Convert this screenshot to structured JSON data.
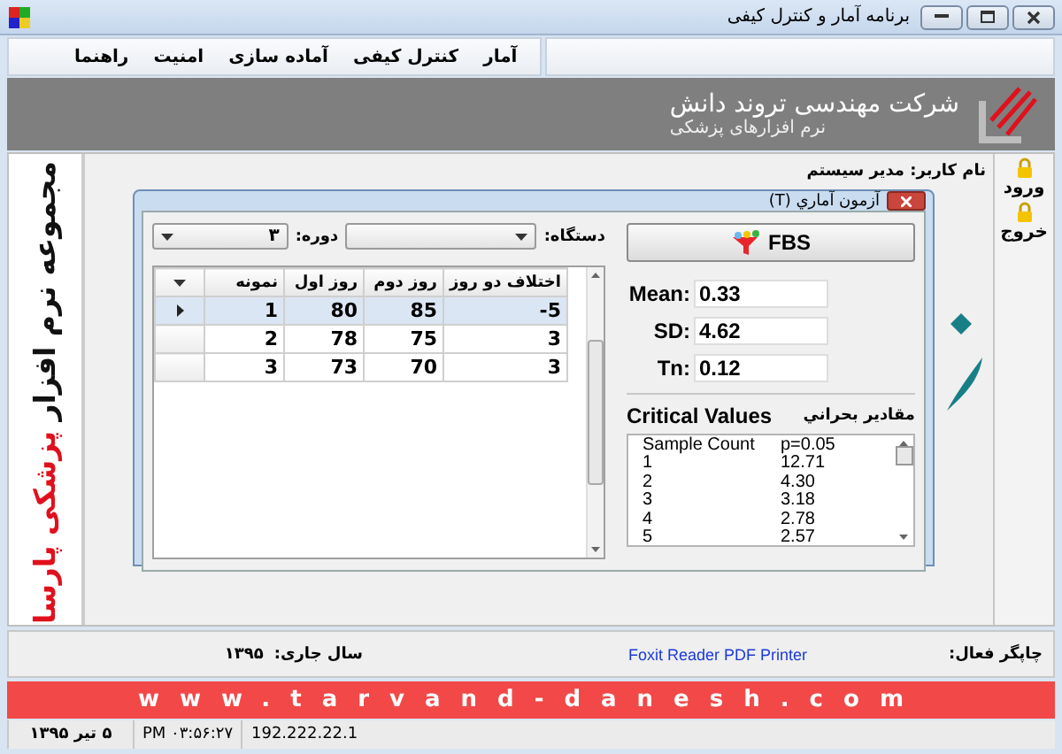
{
  "window": {
    "title": "برنامه آمار و کنترل کیفی"
  },
  "menu": [
    "آمار",
    "کنترل کیفی",
    "آماده سازی",
    "امنیت",
    "راهنما"
  ],
  "banner": {
    "company": "شرکت مهندسی تروند دانش",
    "subtitle": "نرم افزارهای پزشکی"
  },
  "side_text": [
    {
      "text": "مجموعه نرم افزار",
      "color": "#111111"
    },
    {
      "text": "پزشکی پارسا",
      "color": "#e0101c"
    }
  ],
  "user_label": "نام کاربر: مدیر سیستم",
  "sidebar": [
    "ورود",
    "خروج"
  ],
  "dialog": {
    "title": "آزمون آماري (T)",
    "device_label": "دستگاه:",
    "period_label": "دوره:",
    "period_value": "۳",
    "table": {
      "columns": [
        "اختلاف دو روز",
        "روز دوم",
        "روز اول",
        "نمونه"
      ],
      "rows": [
        {
          "cells": [
            "-5",
            "85",
            "80",
            "1"
          ],
          "selected": true
        },
        {
          "cells": [
            "3",
            "75",
            "78",
            "2"
          ],
          "selected": false
        },
        {
          "cells": [
            "3",
            "70",
            "73",
            "3"
          ],
          "selected": false
        }
      ]
    },
    "test_button": "FBS",
    "stats": [
      {
        "label": "Mean:",
        "value": "0.33"
      },
      {
        "label": "SD:",
        "value": "4.62"
      },
      {
        "label": "Tn:",
        "value": "0.12"
      }
    ],
    "critical": {
      "title": "Critical Values",
      "title_fa": "مقادير بحراني",
      "columns": [
        "p=0.05",
        "Sample Count"
      ],
      "rows": [
        [
          "12.71",
          "1"
        ],
        [
          "4.30",
          "2"
        ],
        [
          "3.18",
          "3"
        ],
        [
          "2.78",
          "4"
        ],
        [
          "2.57",
          "5"
        ]
      ]
    }
  },
  "status": {
    "printer_label": "چاپگر فعال:",
    "printer": "Foxit Reader PDF Printer",
    "year_label": "سال جاری:",
    "year": "۱۳۹۵"
  },
  "website": "www.tarvand-danesh.com",
  "status_bar": [
    "192.222.22.1",
    "PM ۰۳:۵۶:۲۷",
    "۵ تیر ۱۳۹۵"
  ]
}
